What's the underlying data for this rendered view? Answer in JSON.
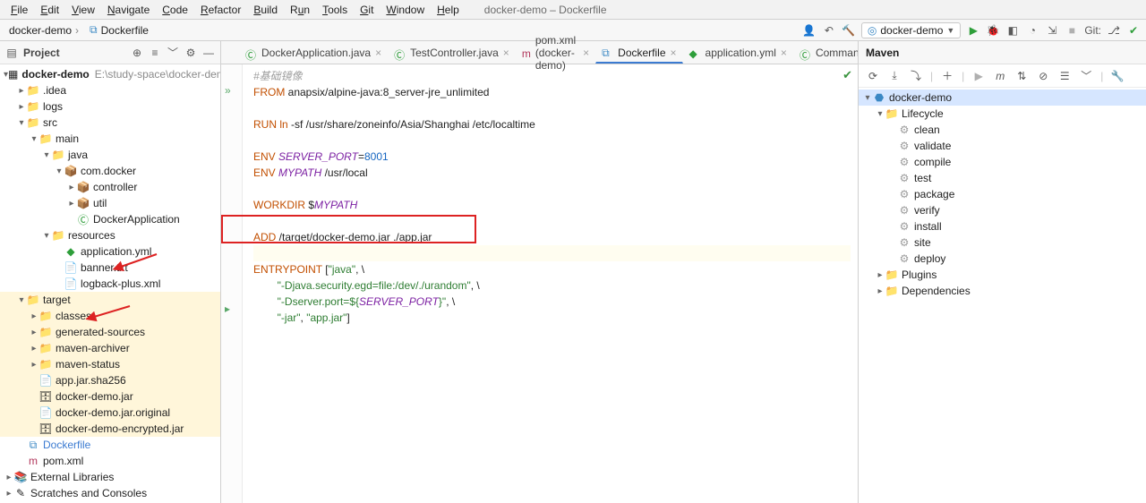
{
  "window": {
    "title": "docker-demo – Dockerfile"
  },
  "menu": [
    "File",
    "Edit",
    "View",
    "Navigate",
    "Code",
    "Refactor",
    "Build",
    "Run",
    "Tools",
    "Git",
    "Window",
    "Help"
  ],
  "breadcrumb": {
    "project": "docker-demo",
    "file": "Dockerfile"
  },
  "runConfig": {
    "label": "docker-demo"
  },
  "gitLabel": "Git:",
  "projectPanel": {
    "title": "Project",
    "root": {
      "name": "docker-demo",
      "path": "E:\\study-space\\docker-demo"
    },
    "idea": ".idea",
    "logs": "logs",
    "src": "src",
    "main": "main",
    "java": "java",
    "pkg": "com.docker",
    "controller": "controller",
    "util": "util",
    "dockerApp": "DockerApplication",
    "resources": "resources",
    "appYml": "application.yml",
    "banner": "banner.txt",
    "logback": "logback-plus.xml",
    "target": "target",
    "classes": "classes",
    "gensrc": "generated-sources",
    "archiver": "maven-archiver",
    "mstatus": "maven-status",
    "sha": "app.jar.sha256",
    "jar": "docker-demo.jar",
    "jarorig": "docker-demo.jar.original",
    "encjar": "docker-demo-encrypted.jar",
    "dockerfile": "Dockerfile",
    "pom": "pom.xml",
    "extlib": "External Libraries",
    "scratches": "Scratches and Consoles"
  },
  "tabs": [
    {
      "label": "DockerApplication.java",
      "active": false,
      "icon": "class"
    },
    {
      "label": "TestController.java",
      "active": false,
      "icon": "class"
    },
    {
      "label": "pom.xml (docker-demo)",
      "active": false,
      "icon": "maven"
    },
    {
      "label": "Dockerfile",
      "active": true,
      "icon": "docker"
    },
    {
      "label": "application.yml",
      "active": false,
      "icon": "yml"
    },
    {
      "label": "CommandResult.ja...",
      "active": false,
      "icon": "class"
    }
  ],
  "code": {
    "l1": "#基础镜像",
    "l2a": "FROM",
    "l2b": " anapsix/alpine-java:8_server-jre_unlimited",
    "l3a": "RUN",
    "l3b": " ln",
    "l3c": " -sf /usr/share/zoneinfo/Asia/Shanghai /etc/localtime",
    "l4a": "ENV",
    "l4b": "SERVER_PORT",
    "l4c": "=",
    "l4d": "8001",
    "l5a": "ENV",
    "l5b": "MYPATH",
    "l5c": " /usr/local",
    "l6a": "WORKDIR",
    "l6b": " $",
    "l6c": "MYPATH",
    "l7a": "ADD",
    "l7b": " /target/docker-demo.jar ./app.jar",
    "l8a": "ENTRYPOINT",
    "l8b": " [",
    "l8c": "\"java\"",
    "l8d": ", \\",
    "l9a": "        ",
    "l9b": "\"-Djava.security.egd=file:/dev/./urandom\"",
    "l9c": ", \\",
    "l10a": "        ",
    "l10b": "\"-Dserver.port=${",
    "l10c": "SERVER_PORT",
    "l10d": "}\"",
    "l10e": ", \\",
    "l11a": "        ",
    "l11b": "\"-jar\"",
    "l11c": ", ",
    "l11d": "\"app.jar\"",
    "l11e": "]"
  },
  "maven": {
    "title": "Maven",
    "root": "docker-demo",
    "lifecycle": "Lifecycle",
    "goals": [
      "clean",
      "validate",
      "compile",
      "test",
      "package",
      "verify",
      "install",
      "site",
      "deploy"
    ],
    "plugins": "Plugins",
    "deps": "Dependencies"
  }
}
